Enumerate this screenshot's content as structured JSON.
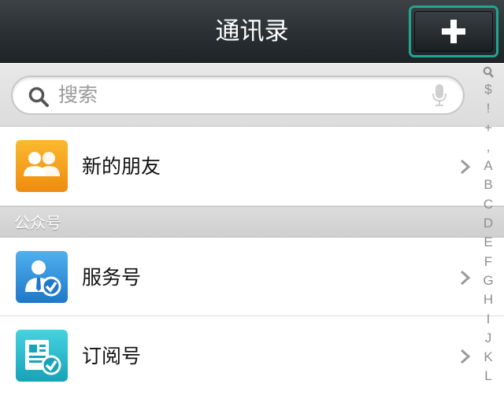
{
  "header": {
    "title": "通讯录",
    "add_button_label": "+"
  },
  "search": {
    "placeholder": "搜索"
  },
  "rows": [
    {
      "label": "新的朋友",
      "icon": "new-friends-icon",
      "color": "#f7a21b"
    },
    {
      "label": "服务号",
      "icon": "service-account-icon",
      "color": "#2f8fd8"
    },
    {
      "label": "订阅号",
      "icon": "subscription-account-icon",
      "color": "#27b4c5"
    }
  ],
  "section": {
    "title": "公众号"
  },
  "index": [
    "$",
    "!",
    "+",
    ",",
    "A",
    "B",
    "C",
    "D",
    "E",
    "F",
    "G",
    "H",
    "I",
    "J",
    "K",
    "L"
  ],
  "colors": {
    "accent": "#1fa692",
    "topbar": "#2a2f33"
  }
}
